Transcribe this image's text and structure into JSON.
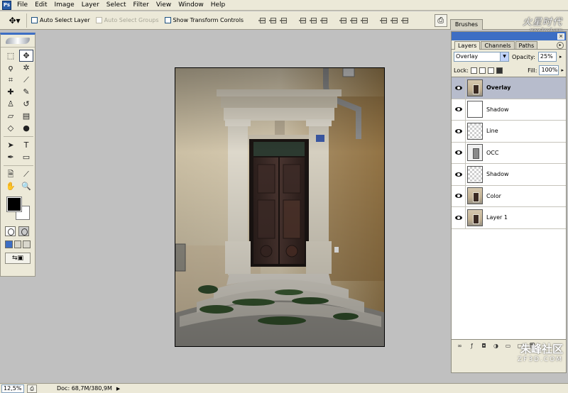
{
  "menubar": {
    "items": [
      "File",
      "Edit",
      "Image",
      "Layer",
      "Select",
      "Filter",
      "View",
      "Window",
      "Help"
    ]
  },
  "options": {
    "auto_select_layer": "Auto Select Layer",
    "auto_select_groups": "Auto Select Groups",
    "show_transform_controls": "Show Transform Controls",
    "brushes_tab": "Brushes"
  },
  "watermark_top": {
    "text": "火星时代",
    "sub": "www.hxsd.com"
  },
  "layers": {
    "tabs": [
      "Layers",
      "Channels",
      "Paths"
    ],
    "blend_mode": "Overlay",
    "opacity_label": "Opacity:",
    "opacity_value": "25%",
    "lock_label": "Lock:",
    "fill_label": "Fill:",
    "fill_value": "100%",
    "items": [
      {
        "name": "Overlay",
        "thumb": "photo",
        "selected": true
      },
      {
        "name": "Shadow",
        "thumb": "white",
        "selected": false
      },
      {
        "name": "Line",
        "thumb": "checker",
        "selected": false
      },
      {
        "name": "OCC",
        "thumb": "occ",
        "selected": false
      },
      {
        "name": "Shadow",
        "thumb": "checker",
        "selected": false
      },
      {
        "name": "Color",
        "thumb": "photo",
        "selected": false
      },
      {
        "name": "Layer 1",
        "thumb": "photo",
        "selected": false
      }
    ]
  },
  "status": {
    "zoom": "12,5%",
    "doc_size": "Doc: 68,7M/380,9M"
  },
  "watermark_bottom": {
    "text": "朱峰社区",
    "sub": "ZF3D.COM"
  },
  "colors": {
    "foreground": "#000000",
    "background": "#ffffff",
    "accent": "#3d6ec4"
  }
}
